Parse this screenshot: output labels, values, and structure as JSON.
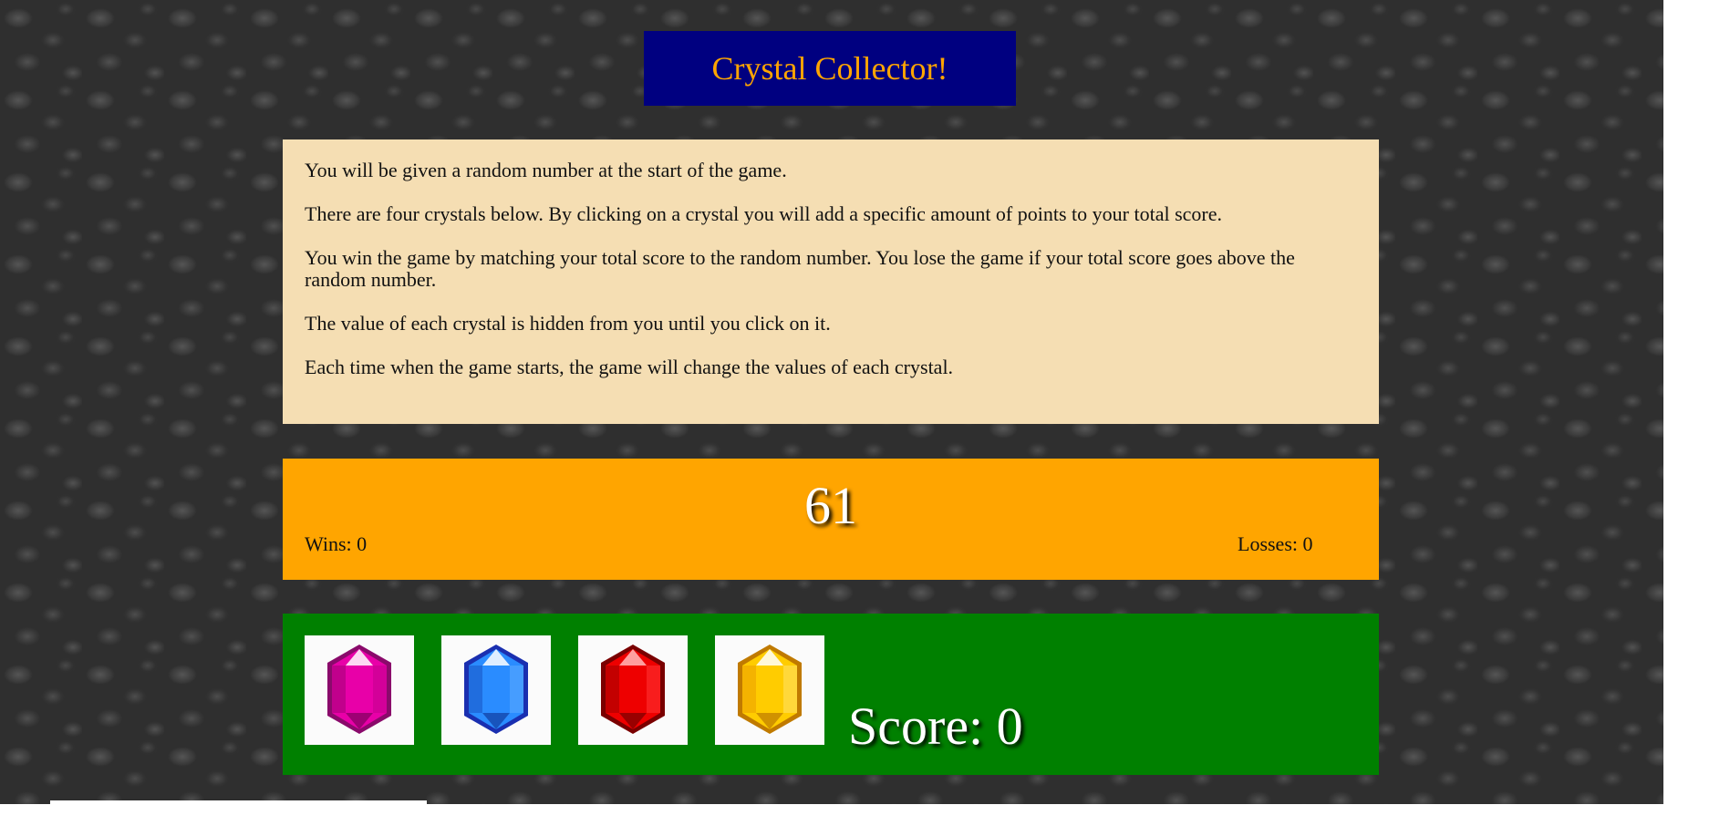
{
  "title": "Crystal Collector!",
  "instructions": [
    "You will be given a random number at the start of the game.",
    "There are four crystals below. By clicking on a crystal you will add a specific amount of points to your total score.",
    "You win the game by matching your total score to the random number. You lose the game if your total score goes above the random number.",
    "The value of each crystal is hidden from you until you click on it.",
    "Each time when the game starts, the game will change the values of each crystal."
  ],
  "game": {
    "target_number": "61",
    "wins_text": "Wins: 0",
    "losses_text": "Losses: 0",
    "score_text": "Score: 0"
  },
  "crystals": [
    {
      "name": "pink-crystal-icon",
      "color": "#e800a8"
    },
    {
      "name": "blue-crystal-icon",
      "color": "#2a8cff"
    },
    {
      "name": "red-crystal-icon",
      "color": "#ee0000"
    },
    {
      "name": "yellow-crystal-icon",
      "color": "#ffcc00"
    }
  ],
  "colors": {
    "title_bg": "#000080",
    "title_text": "#ffa500",
    "instructions_bg": "#f5deb3",
    "number_bg": "#ffa500",
    "crystal_bg": "#008000"
  }
}
